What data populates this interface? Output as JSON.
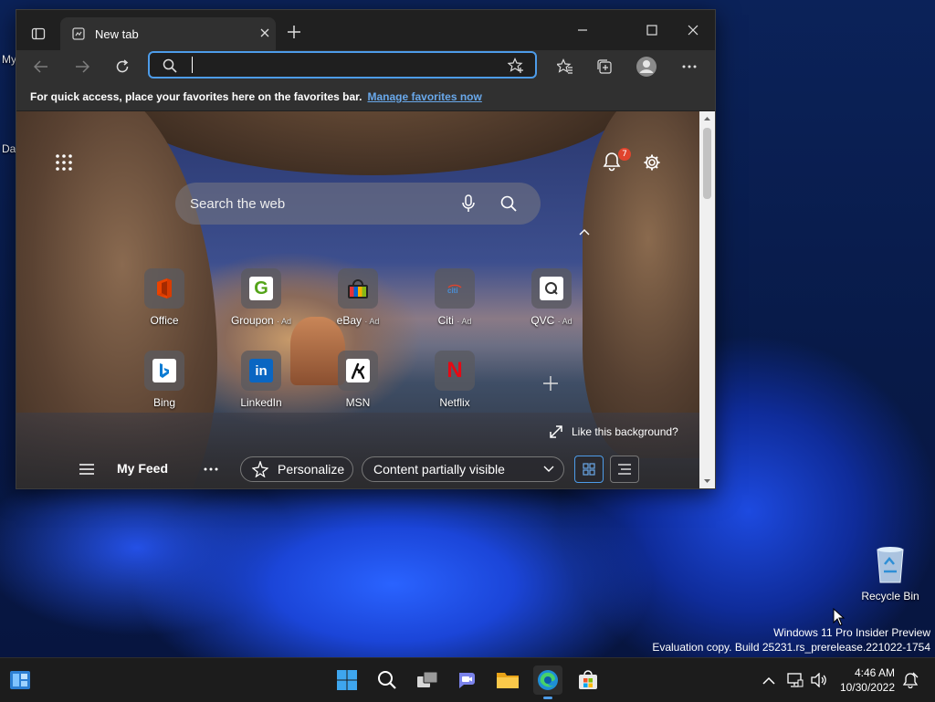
{
  "browser": {
    "tab_title": "New tab",
    "address_value": "",
    "favorites_bar_message": "For quick access, place your favorites here on the favorites bar.",
    "favorites_bar_link": "Manage favorites now"
  },
  "new_tab": {
    "search_placeholder": "Search the web",
    "notification_count": "7",
    "quick_links_row1": [
      {
        "label": "Office",
        "ad": ""
      },
      {
        "label": "Groupon",
        "ad": "· Ad"
      },
      {
        "label": "eBay",
        "ad": "· Ad"
      },
      {
        "label": "Citi",
        "ad": "· Ad"
      },
      {
        "label": "QVC",
        "ad": "· Ad"
      }
    ],
    "quick_links_row2": [
      {
        "label": "Bing"
      },
      {
        "label": "LinkedIn"
      },
      {
        "label": "MSN"
      },
      {
        "label": "Netflix"
      }
    ],
    "like_background": "Like this background?",
    "feed": {
      "title": "My Feed",
      "personalize": "Personalize",
      "content_select": "Content partially visible"
    }
  },
  "desktop": {
    "partial_label_1": "My",
    "partial_label_2": "Da",
    "recycle_bin": "Recycle Bin",
    "watermark_line1": "Windows 11 Pro Insider Preview",
    "watermark_line2": "Evaluation copy. Build 25231.rs_prerelease.221022-1754"
  },
  "taskbar": {
    "time": "4:46 AM",
    "date": "10/30/2022"
  },
  "colors": {
    "accent": "#4d9ce9",
    "link": "#69a8ea",
    "badge": "#e0442d"
  }
}
